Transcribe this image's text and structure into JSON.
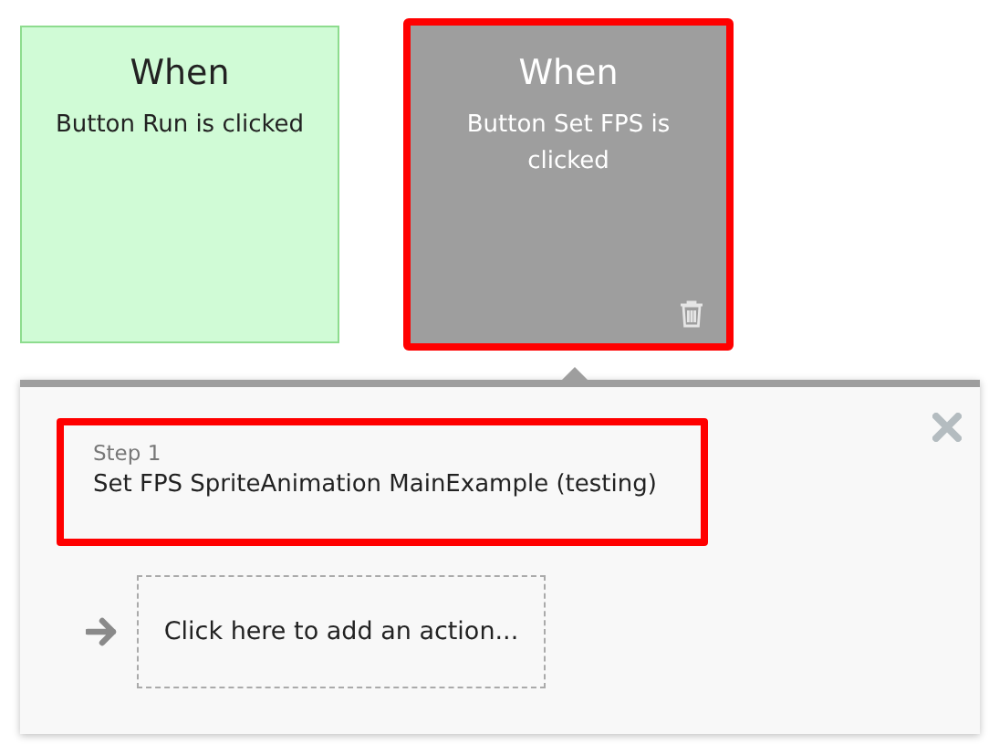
{
  "events": [
    {
      "title": "When",
      "description": "Button Run is clicked",
      "selected": false
    },
    {
      "title": "When",
      "description": "Button Set FPS is clicked",
      "selected": true
    }
  ],
  "workflow": {
    "steps": [
      {
        "label": "Step 1",
        "action": "Set FPS SpriteAnimation MainExample (testing)",
        "selected": true
      }
    ],
    "add_action": "Click here to add an action..."
  }
}
